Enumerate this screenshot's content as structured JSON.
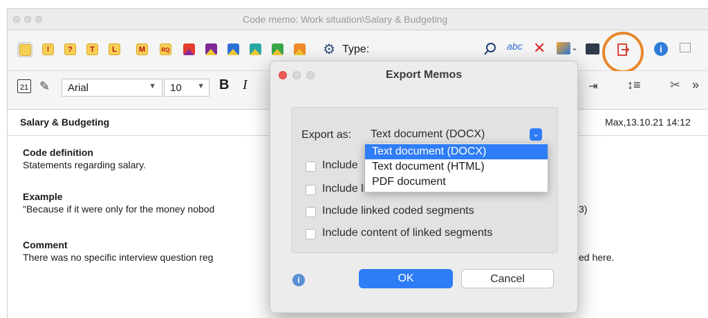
{
  "window": {
    "title": "Code memo: Work situation\\Salary & Budgeting"
  },
  "toolbar": {
    "type_label": "Type:",
    "memo_letters": [
      "!",
      "?",
      "T",
      "L",
      "M",
      "RQ"
    ],
    "icons": [
      "memo-yellow-icon",
      "exclamation-memo-icon",
      "question-memo-icon",
      "t-memo-icon",
      "l-memo-icon",
      "m-memo-icon",
      "rq-memo-icon",
      "red-purple-flag-icon",
      "purple-yellow-flag-icon",
      "blue-flag-icon",
      "teal-flag-icon",
      "green-flag-icon",
      "orange-flag-icon",
      "gear-icon",
      "search-icon",
      "spellcheck-icon",
      "delete-icon",
      "image-icon",
      "print-icon",
      "export-icon",
      "info-icon",
      "window-icon"
    ],
    "highlight_color": "#E8872C"
  },
  "format": {
    "font": "Arial",
    "size": "10",
    "bold": "B",
    "italic": "I"
  },
  "memo": {
    "title": "Salary & Budgeting",
    "meta": "Max,13.10.21 14:12",
    "sections": [
      {
        "heading": "Code definition",
        "text": "Statements regarding salary."
      },
      {
        "heading": "Example",
        "text": "\"Because if it were only for the money nobod",
        "tail": "3)"
      },
      {
        "heading": "Comment",
        "text": "There was no specific interview question reg",
        "tail": "ed here."
      }
    ]
  },
  "dialog": {
    "title": "Export Memos",
    "export_as_label": "Export as:",
    "selected": "Text document (DOCX)",
    "options": [
      "Text document (DOCX)",
      "Text document (HTML)",
      "PDF document"
    ],
    "checkboxes": [
      "Include",
      "Include linked codes",
      "Include linked coded segments",
      "Include content of linked segments"
    ],
    "ok": "OK",
    "cancel": "Cancel",
    "accent_color": "#2F7DF6"
  }
}
